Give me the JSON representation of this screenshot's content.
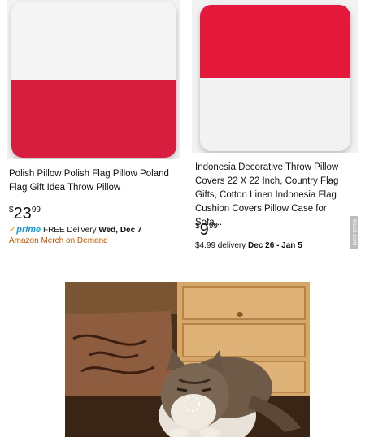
{
  "products": [
    {
      "title": "Polish Pillow Polish Flag Pillow Poland Flag Gift Idea Throw Pillow",
      "price_symbol": "$",
      "price_whole": "23",
      "price_cents": "99",
      "prime_label": "prime",
      "delivery_prefix": "FREE Delivery ",
      "delivery_date": "Wed, Dec 7",
      "seller": "Amazon Merch on Demand",
      "flag_top_color": "#f2f2f2",
      "flag_bottom_color": "#d81e3f"
    },
    {
      "title": "Indonesia Decorative Throw Pillow Covers 22 X 22 Inch, Country Flag Gifts, Cotton Linen Indonesia Flag Cushion Covers Pillow Case for Sofa...",
      "price_symbol": "$",
      "price_whole": "9",
      "price_cents": "99",
      "delivery_prefix": "$4.99 delivery ",
      "delivery_date": "Dec 26 - Jan 5",
      "flag_top_color": "#e4183a",
      "flag_bottom_color": "#f2f2f2"
    }
  ],
  "watermark": "9GAG.COM",
  "meme": {
    "description_icon": "loading-spinner-icon"
  }
}
